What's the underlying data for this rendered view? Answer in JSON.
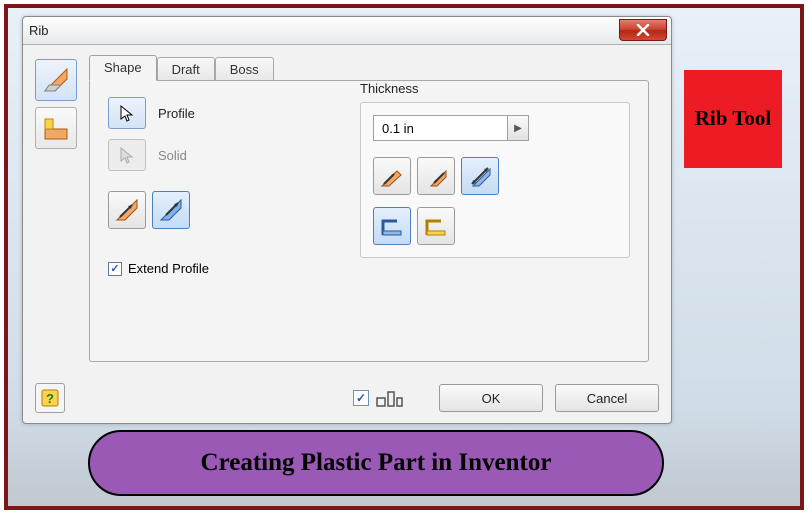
{
  "dialog": {
    "title": "Rib",
    "tabs": [
      "Shape",
      "Draft",
      "Boss"
    ],
    "active_tab": 0,
    "profile_label": "Profile",
    "solid_label": "Solid",
    "extend_label": "Extend Profile",
    "extend_checked": true
  },
  "thickness": {
    "label": "Thickness",
    "value": "0.1 in"
  },
  "buttons": {
    "ok": "OK",
    "cancel": "Cancel"
  },
  "annotations": {
    "side_label": "Rib Tool",
    "caption": "Creating Plastic Part in Inventor"
  },
  "preview_checked": true
}
